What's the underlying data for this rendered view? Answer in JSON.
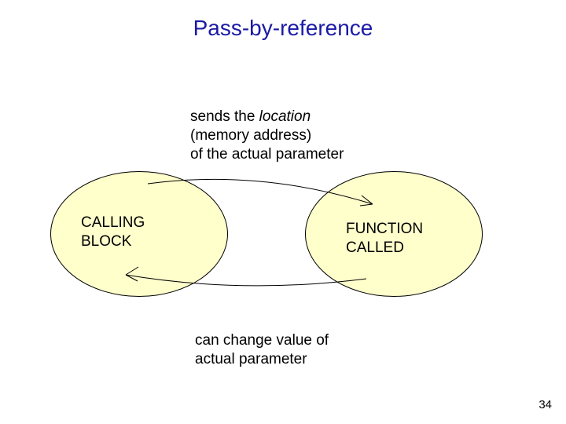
{
  "title": "Pass-by-reference",
  "top_note": {
    "line1a": "sends the ",
    "line1b": "location",
    "line2": "(memory address)",
    "line3": "of the actual  parameter"
  },
  "left_ellipse": {
    "line1": "CALLING",
    "line2": "BLOCK"
  },
  "right_ellipse": {
    "line1": "FUNCTION",
    "line2": "CALLED"
  },
  "bottom_note": {
    "line1": "can change value  of",
    "line2": "actual  parameter"
  },
  "page_number": "34"
}
